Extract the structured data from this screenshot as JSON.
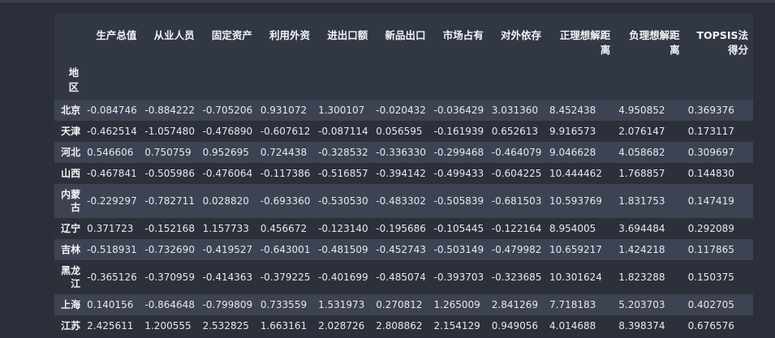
{
  "index_header": "地区",
  "columns": [
    "生产总值",
    "从业人员",
    "固定资产",
    "利用外资",
    "进出口额",
    "新品出口",
    "市场占有",
    "对外依存",
    "正理想解距离",
    "负理想解距离",
    "TOPSIS法得分"
  ],
  "column_lines": [
    [
      "生产总值"
    ],
    [
      "从业人员"
    ],
    [
      "固定资产"
    ],
    [
      "利用外资"
    ],
    [
      "进出口额"
    ],
    [
      "新品出口"
    ],
    [
      "市场占有"
    ],
    [
      "对外依存"
    ],
    [
      "正理想解距",
      "离"
    ],
    [
      "负理想解距",
      "离"
    ],
    [
      "TOPSIS法",
      "得分"
    ]
  ],
  "rows": [
    {
      "region": [
        "北京"
      ],
      "values": [
        "-0.084746",
        "-0.884222",
        "-0.705206",
        "0.931072",
        "1.300107",
        "-0.020432",
        "-0.036429",
        "3.031360",
        "8.452438",
        "4.950852",
        "0.369376"
      ]
    },
    {
      "region": [
        "天津"
      ],
      "values": [
        "-0.462514",
        "-1.057480",
        "-0.476890",
        "-0.607612",
        "-0.087114",
        "0.056595",
        "-0.161939",
        "0.652613",
        "9.916573",
        "2.076147",
        "0.173117"
      ]
    },
    {
      "region": [
        "河北"
      ],
      "values": [
        "0.546606",
        "0.750759",
        "0.952695",
        "0.724438",
        "-0.328532",
        "-0.336330",
        "-0.299468",
        "-0.464079",
        "9.046628",
        "4.058682",
        "0.309697"
      ]
    },
    {
      "region": [
        "山西"
      ],
      "values": [
        "-0.467841",
        "-0.505986",
        "-0.476064",
        "-0.117386",
        "-0.516857",
        "-0.394142",
        "-0.499433",
        "-0.604225",
        "10.444462",
        "1.768857",
        "0.144830"
      ]
    },
    {
      "region": [
        "内蒙",
        "古"
      ],
      "values": [
        "-0.229297",
        "-0.782711",
        "0.028820",
        "-0.693360",
        "-0.530530",
        "-0.483302",
        "-0.505839",
        "-0.681503",
        "10.593769",
        "1.831753",
        "0.147419"
      ]
    },
    {
      "region": [
        "辽宁"
      ],
      "values": [
        "0.371723",
        "-0.152168",
        "1.157733",
        "0.456672",
        "-0.123140",
        "-0.195686",
        "-0.105445",
        "-0.122164",
        "8.954005",
        "3.694484",
        "0.292089"
      ]
    },
    {
      "region": [
        "吉林"
      ],
      "values": [
        "-0.518931",
        "-0.732690",
        "-0.419527",
        "-0.643001",
        "-0.481509",
        "-0.452743",
        "-0.503149",
        "-0.479982",
        "10.659217",
        "1.424218",
        "0.117865"
      ]
    },
    {
      "region": [
        "黑龙",
        "江"
      ],
      "values": [
        "-0.365126",
        "-0.370959",
        "-0.414363",
        "-0.379225",
        "-0.401699",
        "-0.485074",
        "-0.393703",
        "-0.323685",
        "10.301624",
        "1.823288",
        "0.150375"
      ]
    },
    {
      "region": [
        "上海"
      ],
      "values": [
        "0.140156",
        "-0.864648",
        "-0.799809",
        "0.733559",
        "1.531973",
        "0.270812",
        "1.265009",
        "2.841269",
        "7.718183",
        "5.203703",
        "0.402705"
      ]
    },
    {
      "region": [
        "江苏"
      ],
      "values": [
        "2.425611",
        "1.200555",
        "2.532825",
        "1.663161",
        "2.028726",
        "2.808862",
        "2.154129",
        "0.949056",
        "4.014688",
        "8.398374",
        "0.676576"
      ]
    }
  ]
}
